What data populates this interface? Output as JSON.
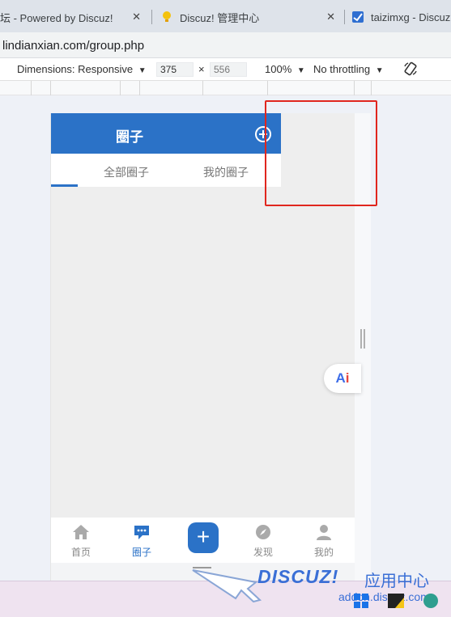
{
  "browser": {
    "tabs": [
      {
        "title": "坛 - Powered by Discuz!",
        "close": "✕"
      },
      {
        "title": "Discuz! 管理中心",
        "close": "✕"
      },
      {
        "title": "taizimxg - Discuz"
      }
    ],
    "url": "lindianxian.com/group.php"
  },
  "devtools": {
    "dimensions_label": "Dimensions: Responsive",
    "width": "375",
    "times": "×",
    "height": "556",
    "zoom": "100%",
    "throttling": "No throttling",
    "dropdown_arrow": "▼"
  },
  "mobile": {
    "header_title": "圈子",
    "tabs": [
      "全部圈子",
      "我的圈子"
    ],
    "nav": [
      {
        "label": "首页",
        "icon": "home-icon"
      },
      {
        "label": "圈子",
        "icon": "chat-icon",
        "active": true
      },
      {
        "label": "",
        "icon": "plus-icon"
      },
      {
        "label": "发现",
        "icon": "compass-icon"
      },
      {
        "label": "我的",
        "icon": "user-icon"
      }
    ],
    "plus_symbol": "+"
  },
  "ai_button": {
    "a": "A",
    "i": "i"
  },
  "watermark": {
    "logo": "DISCUZ!",
    "cn": "应用中心",
    "url": "addon.discuz.com"
  },
  "colors": {
    "brand_blue": "#2b72c7",
    "annotation_red": "#e0261e"
  }
}
